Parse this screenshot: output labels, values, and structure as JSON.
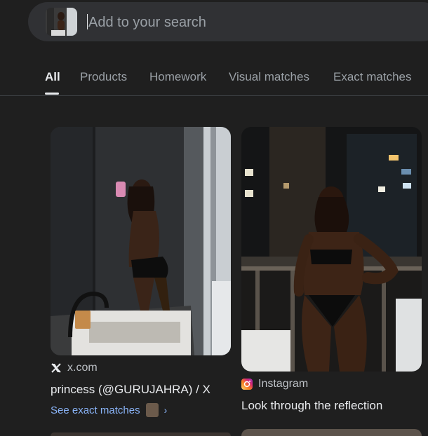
{
  "search": {
    "placeholder": "Add to your search",
    "thumbnail_icon": "image-thumbnail"
  },
  "tabs": [
    {
      "label": "All",
      "active": true
    },
    {
      "label": "Products",
      "active": false
    },
    {
      "label": "Homework",
      "active": false
    },
    {
      "label": "Visual matches",
      "active": false
    },
    {
      "label": "Exact matches",
      "active": false
    }
  ],
  "results": [
    {
      "source_icon": "x-logo-icon",
      "source": "x.com",
      "title": "princess (@GURUJAHRA) / X",
      "link": "See exact matches"
    },
    {
      "source_icon": "instagram-icon",
      "source": "Instagram",
      "title": "Look through the reflection"
    }
  ],
  "colors": {
    "background": "#1f1f1f",
    "search_bg": "#303134",
    "link": "#8ab4f8",
    "muted": "#9aa0a6",
    "text": "#e8eaed"
  }
}
